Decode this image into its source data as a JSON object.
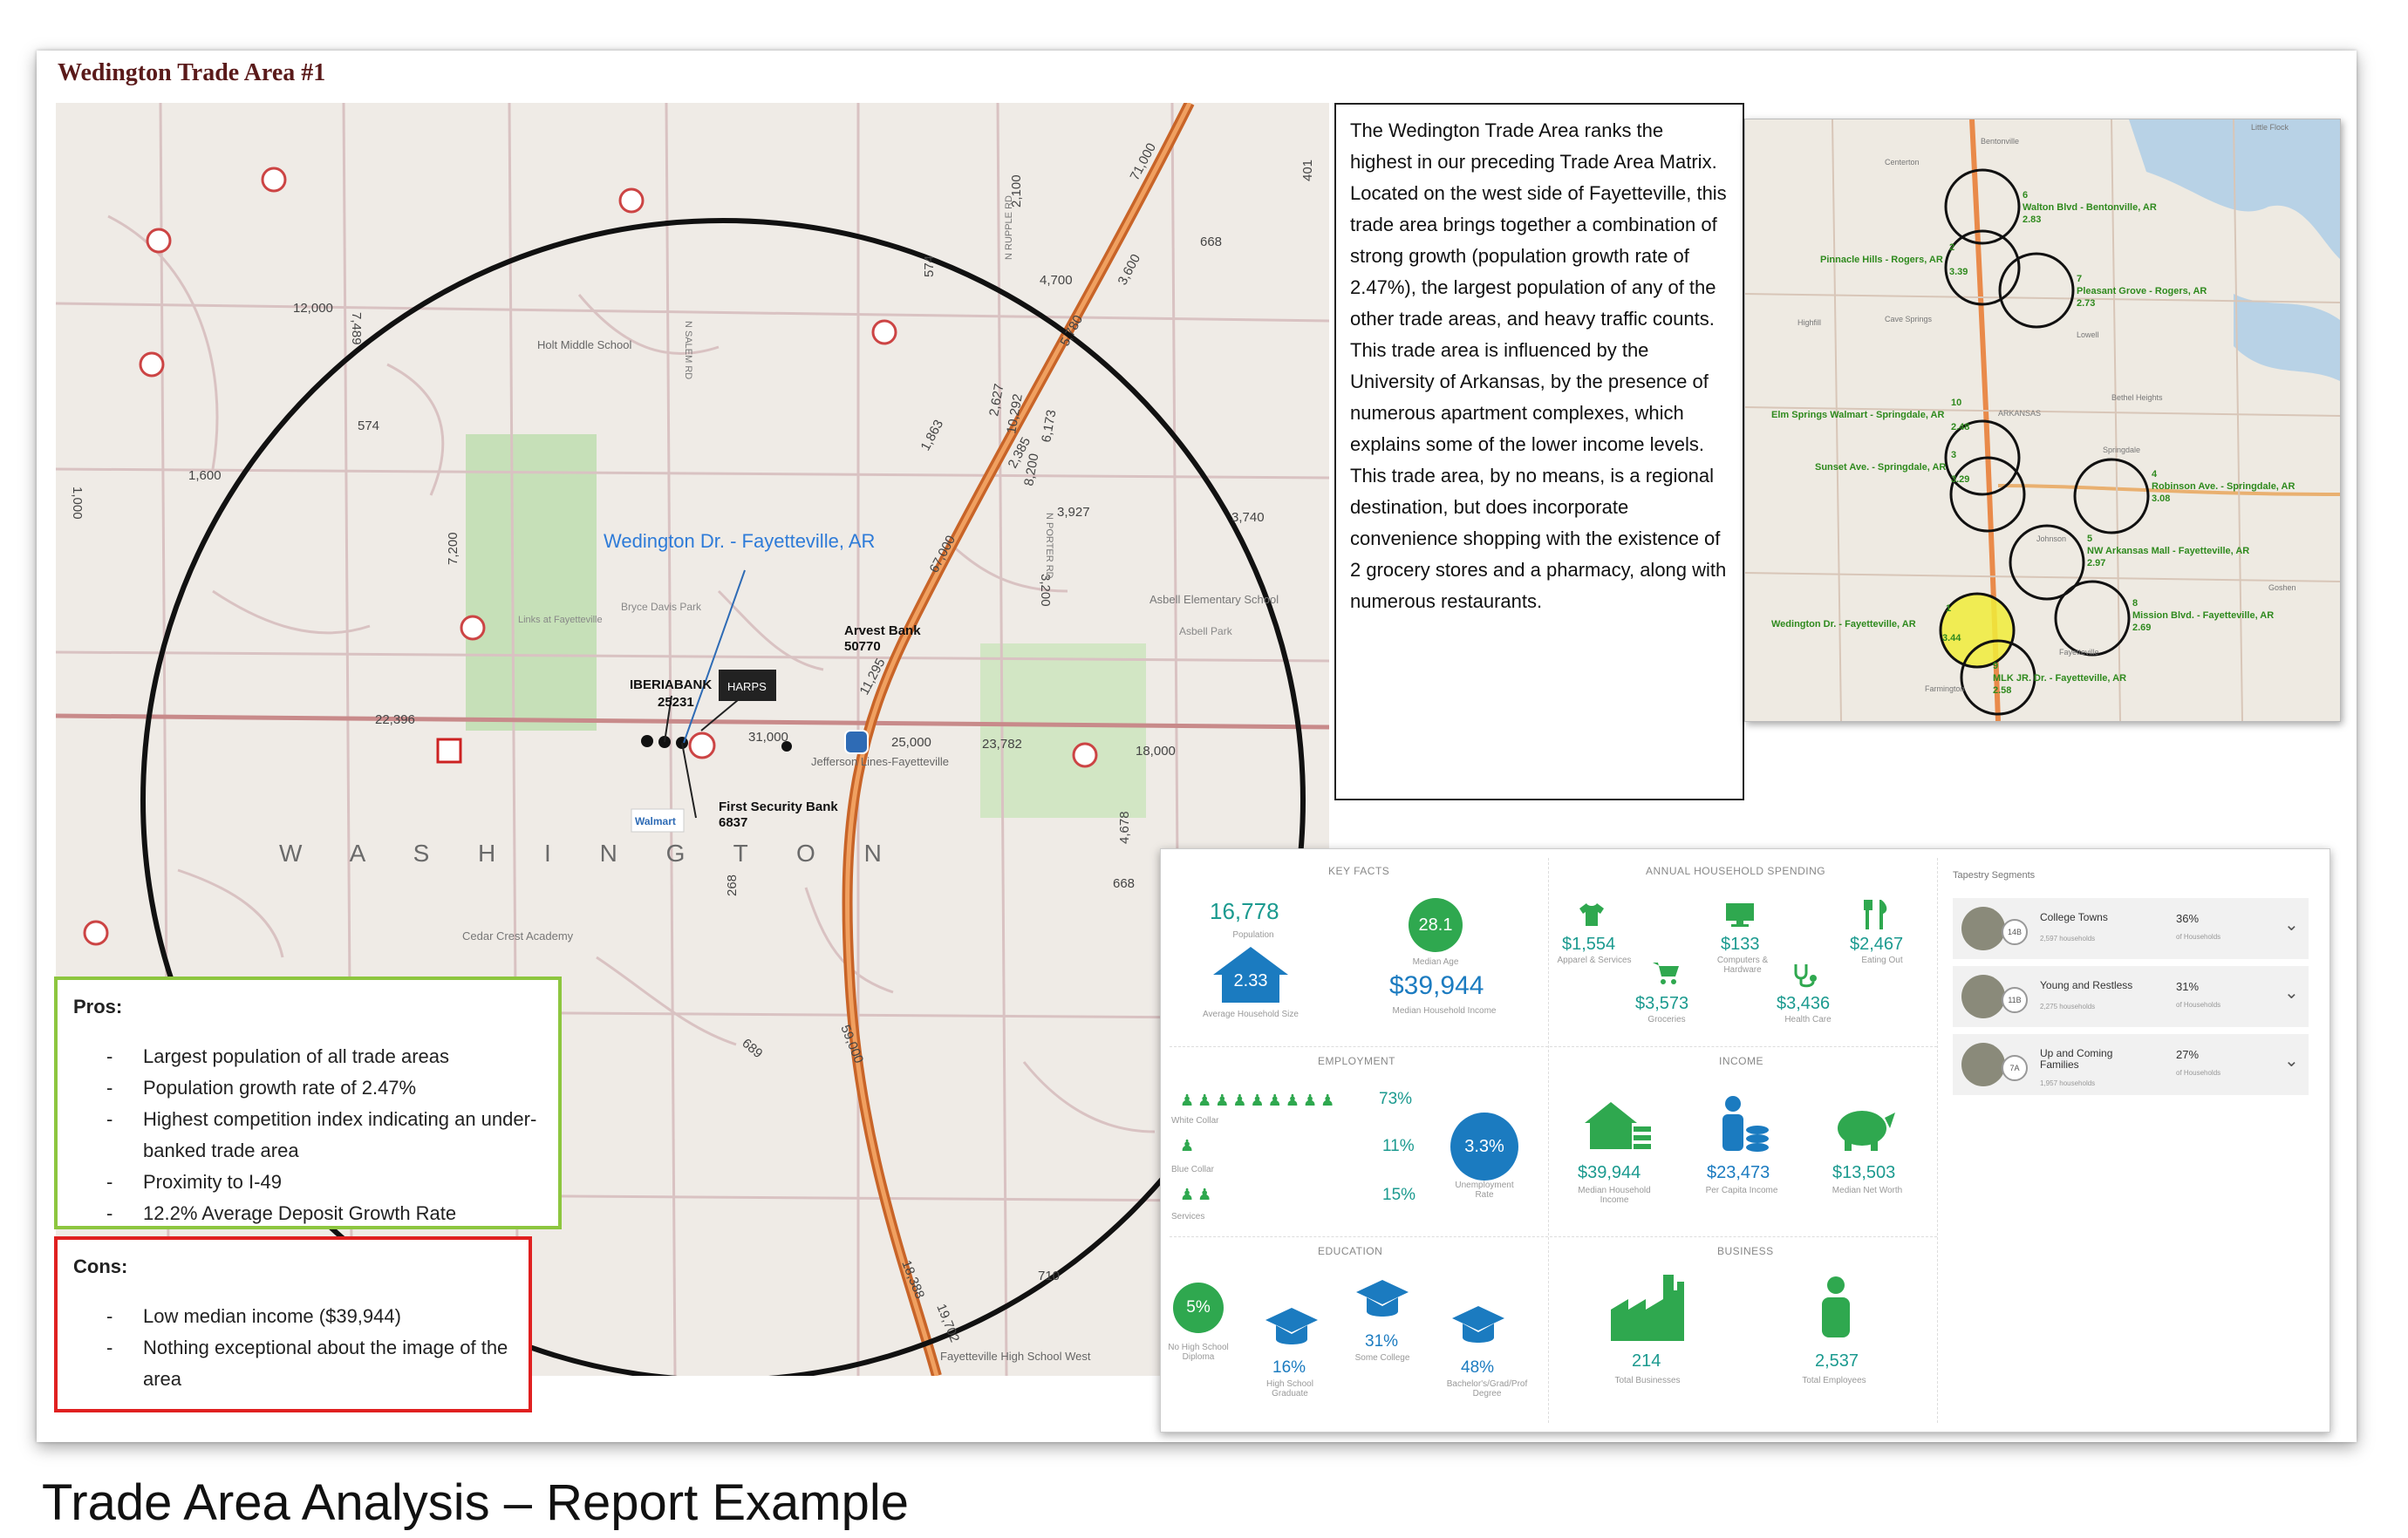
{
  "sheet_title": "Wedington Trade Area #1",
  "caption": "Trade Area Analysis – Report Example",
  "narrative": "The Wedington Trade Area ranks the highest in our preceding Trade Area Matrix.  Located on the west side of Fayetteville, this trade area brings together a combination of strong growth (population growth rate of 2.47%), the largest population of any of the other trade areas, and heavy traffic counts.  This trade area is influenced by the University of Arkansas, by the presence of numerous apartment complexes, which explains some of the lower income levels.  This trade area, by no means, is a regional destination, but does incorporate convenience shopping with the existence of 2 grocery stores and a pharmacy, along with numerous restaurants.",
  "pros": {
    "label": "Pros:",
    "items": [
      "Largest population of all trade areas",
      "Population growth rate of 2.47%",
      "Highest competition index indicating an under-banked trade area",
      "Proximity to I-49",
      "12.2% Average Deposit Growth Rate"
    ]
  },
  "cons": {
    "label": "Cons:",
    "items": [
      "Low median income ($39,944)",
      "Nothing exceptional about the image of the area"
    ]
  },
  "map": {
    "site_label": "Wedington Dr. - Fayetteville, AR",
    "banks": {
      "iberiabank": "IBERIABANK",
      "iberiabank_num": "25231",
      "arvest": "Arvest Bank",
      "arvest_num": "50770",
      "first_security": "First Security Bank",
      "first_security_num": "6837",
      "harps": "HARPS",
      "walmart": "Walmart"
    },
    "places": {
      "holt": "Holt Middle School",
      "bryce": "Bryce Davis Park",
      "links": "Links at Fayetteville",
      "asbell_school": "Asbell Elementary School",
      "asbell_park": "Asbell Park",
      "jefferson": "Jefferson Lines-Fayetteville",
      "cedar": "Cedar Crest Academy",
      "fayetteville_high": "Fayetteville High School West",
      "washington": "W  A  S  H  I  N  G  T  O  N"
    },
    "traffic": [
      "12,000",
      "1,600",
      "574",
      "22,396",
      "31,000",
      "25,000",
      "23,782",
      "18,000",
      "4,700",
      "3,927",
      "3,740",
      "668",
      "71,000",
      "67,000",
      "59,000",
      "11,295",
      "10,292",
      "1,863",
      "2,627",
      "2,385",
      "5,780",
      "3,600",
      "6,173",
      "8,200",
      "3,200",
      "7,489",
      "7,200",
      "2,100",
      "1,000",
      "4,678",
      "689",
      "710",
      "401",
      "574",
      "668",
      "268",
      "18,388",
      "19,702"
    ],
    "roads": {
      "salem": "N SALEM RD",
      "rupple": "N RUPPLE RD",
      "porter": "N PORTER RD"
    }
  },
  "regional_map": {
    "locations": [
      {
        "num": "6",
        "name": "Walton Blvd - Bentonville, AR",
        "score": "2.83"
      },
      {
        "num": "2",
        "name": "Pinnacle Hills - Rogers, AR",
        "score": "3.39"
      },
      {
        "num": "7",
        "name": "Pleasant Grove - Rogers, AR",
        "score": "2.73"
      },
      {
        "num": "10",
        "name": "Elm Springs Walmart - Springdale, AR",
        "score": "2.48"
      },
      {
        "num": "3",
        "name": "Sunset Ave. - Springdale, AR",
        "score": "3.29"
      },
      {
        "num": "4",
        "name": "Robinson Ave. - Springdale, AR",
        "score": "3.08"
      },
      {
        "num": "5",
        "name": "NW Arkansas Mall - Fayetteville, AR",
        "score": "2.97"
      },
      {
        "num": "8",
        "name": "Mission Blvd. - Fayetteville, AR",
        "score": "2.69"
      },
      {
        "num": "1",
        "name": "Wedington Dr. - Fayetteville, AR",
        "score": "3.44"
      },
      {
        "num": "9",
        "name": "MLK JR. Dr. - Fayetteville, AR",
        "score": "2.58"
      }
    ],
    "towns": [
      "Bentonville",
      "Centerton",
      "Highfill",
      "Cave Springs",
      "Lowell",
      "Bethel Heights",
      "ARKANSAS",
      "Springdale",
      "Johnson",
      "Goshen",
      "Fayetteville",
      "Farmington",
      "Little Flock"
    ]
  },
  "infographic": {
    "key_facts": {
      "heading": "KEY FACTS",
      "population": "16,778",
      "population_label": "Population",
      "median_age": "28.1",
      "median_age_label": "Median Age",
      "household_size": "2.33",
      "household_size_label": "Average Household Size",
      "median_income": "$39,944",
      "median_income_label": "Median Household Income"
    },
    "spending": {
      "heading": "ANNUAL HOUSEHOLD SPENDING",
      "apparel": "$1,554",
      "apparel_label": "Apparel & Services",
      "computers": "$133",
      "computers_label": "Computers & Hardware",
      "eating": "$2,467",
      "eating_label": "Eating Out",
      "groceries": "$3,573",
      "groceries_label": "Groceries",
      "health": "$3,436",
      "health_label": "Health Care"
    },
    "employment": {
      "heading": "EMPLOYMENT",
      "white_collar": "73%",
      "white_collar_label": "White Collar",
      "blue_collar": "11%",
      "blue_collar_label": "Blue Collar",
      "services": "15%",
      "services_label": "Services",
      "unemployment": "3.3%",
      "unemployment_label": "Unemployment Rate"
    },
    "income": {
      "heading": "INCOME",
      "median_household": "$39,944",
      "median_household_label": "Median Household Income",
      "per_capita": "$23,473",
      "per_capita_label": "Per Capita Income",
      "net_worth": "$13,503",
      "net_worth_label": "Median Net Worth"
    },
    "education": {
      "heading": "EDUCATION",
      "no_hs": "5%",
      "no_hs_label": "No High School Diploma",
      "hs": "16%",
      "hs_label": "High School Graduate",
      "some_college": "31%",
      "some_college_label": "Some College",
      "bachelors": "48%",
      "bachelors_label": "Bachelor's/Grad/Prof Degree"
    },
    "business": {
      "heading": "BUSINESS",
      "businesses": "214",
      "businesses_label": "Total Businesses",
      "employees": "2,537",
      "employees_label": "Total Employees"
    },
    "tapestry": {
      "heading": "Tapestry Segments",
      "segments": [
        {
          "badge": "14B",
          "name": "College Towns",
          "households": "2,597 households",
          "pct": "36%",
          "pct_label": "of Households"
        },
        {
          "badge": "11B",
          "name": "Young and Restless",
          "households": "2,275 households",
          "pct": "31%",
          "pct_label": "of Households"
        },
        {
          "badge": "7A",
          "name": "Up and Coming Families",
          "households": "1,957 households",
          "pct": "27%",
          "pct_label": "of Households"
        }
      ]
    },
    "colors": {
      "teal": "#1b9a8f",
      "blue": "#1b7bc0",
      "green": "#2fa84f"
    }
  }
}
